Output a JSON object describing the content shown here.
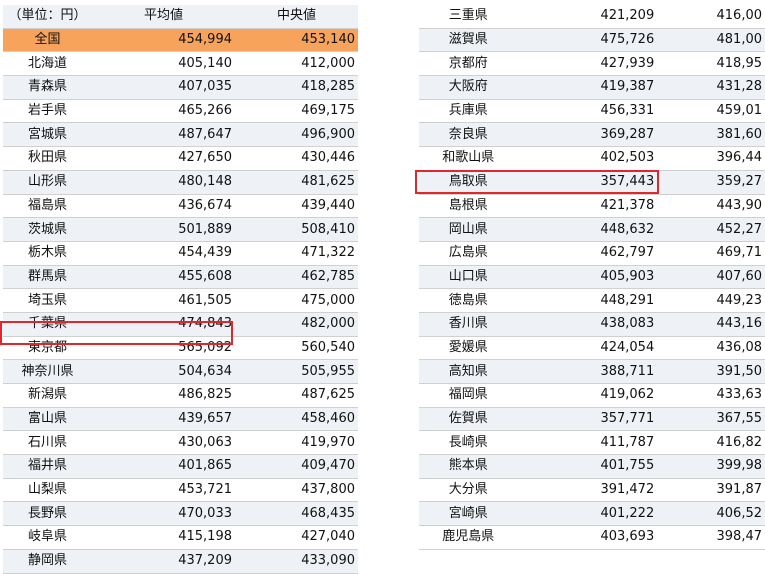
{
  "left_table": {
    "header": {
      "unit": "（単位：円）",
      "mean": "平均値",
      "median": "中央値"
    },
    "rows": [
      {
        "pref": "全国",
        "mean": "454,994",
        "median": "453,140"
      },
      {
        "pref": "北海道",
        "mean": "405,140",
        "median": "412,000"
      },
      {
        "pref": "青森県",
        "mean": "407,035",
        "median": "418,285"
      },
      {
        "pref": "岩手県",
        "mean": "465,266",
        "median": "469,175"
      },
      {
        "pref": "宮城県",
        "mean": "487,647",
        "median": "496,900"
      },
      {
        "pref": "秋田県",
        "mean": "427,650",
        "median": "430,446"
      },
      {
        "pref": "山形県",
        "mean": "480,148",
        "median": "481,625"
      },
      {
        "pref": "福島県",
        "mean": "436,674",
        "median": "439,440"
      },
      {
        "pref": "茨城県",
        "mean": "501,889",
        "median": "508,410"
      },
      {
        "pref": "栃木県",
        "mean": "454,439",
        "median": "471,322"
      },
      {
        "pref": "群馬県",
        "mean": "455,608",
        "median": "462,785"
      },
      {
        "pref": "埼玉県",
        "mean": "461,505",
        "median": "475,000"
      },
      {
        "pref": "千葉県",
        "mean": "474,843",
        "median": "482,000"
      },
      {
        "pref": "東京都",
        "mean": "565,092",
        "median": "560,540"
      },
      {
        "pref": "神奈川県",
        "mean": "504,634",
        "median": "505,955"
      },
      {
        "pref": "新潟県",
        "mean": "486,825",
        "median": "487,625"
      },
      {
        "pref": "富山県",
        "mean": "439,657",
        "median": "458,460"
      },
      {
        "pref": "石川県",
        "mean": "430,063",
        "median": "419,970"
      },
      {
        "pref": "福井県",
        "mean": "401,865",
        "median": "409,470"
      },
      {
        "pref": "山梨県",
        "mean": "453,721",
        "median": "437,800"
      },
      {
        "pref": "長野県",
        "mean": "470,033",
        "median": "468,435"
      },
      {
        "pref": "岐阜県",
        "mean": "415,198",
        "median": "427,040"
      },
      {
        "pref": "静岡県",
        "mean": "437,209",
        "median": "433,090"
      }
    ]
  },
  "right_table": {
    "rows": [
      {
        "pref": "三重県",
        "mean": "421,209",
        "median": "416,00"
      },
      {
        "pref": "滋賀県",
        "mean": "475,726",
        "median": "481,00"
      },
      {
        "pref": "京都府",
        "mean": "427,939",
        "median": "418,95"
      },
      {
        "pref": "大阪府",
        "mean": "419,387",
        "median": "431,28"
      },
      {
        "pref": "兵庫県",
        "mean": "456,331",
        "median": "459,01"
      },
      {
        "pref": "奈良県",
        "mean": "369,287",
        "median": "381,60"
      },
      {
        "pref": "和歌山県",
        "mean": "402,503",
        "median": "396,44"
      },
      {
        "pref": "鳥取県",
        "mean": "357,443",
        "median": "359,27"
      },
      {
        "pref": "島根県",
        "mean": "421,378",
        "median": "443,90"
      },
      {
        "pref": "岡山県",
        "mean": "448,632",
        "median": "452,27"
      },
      {
        "pref": "広島県",
        "mean": "462,797",
        "median": "469,71"
      },
      {
        "pref": "山口県",
        "mean": "405,903",
        "median": "407,60"
      },
      {
        "pref": "徳島県",
        "mean": "448,291",
        "median": "449,23"
      },
      {
        "pref": "香川県",
        "mean": "438,083",
        "median": "443,16"
      },
      {
        "pref": "愛媛県",
        "mean": "424,054",
        "median": "436,08"
      },
      {
        "pref": "高知県",
        "mean": "388,711",
        "median": "391,50"
      },
      {
        "pref": "福岡県",
        "mean": "419,062",
        "median": "433,63"
      },
      {
        "pref": "佐賀県",
        "mean": "357,771",
        "median": "367,55"
      },
      {
        "pref": "長崎県",
        "mean": "411,787",
        "median": "416,82"
      },
      {
        "pref": "熊本県",
        "mean": "401,755",
        "median": "399,98"
      },
      {
        "pref": "大分県",
        "mean": "391,472",
        "median": "391,87"
      },
      {
        "pref": "宮崎県",
        "mean": "401,222",
        "median": "406,52"
      },
      {
        "pref": "鹿児島県",
        "mean": "403,693",
        "median": "398,47"
      }
    ]
  },
  "highlighted": [
    "東京都",
    "鳥取県"
  ],
  "colors": {
    "national_row": "#f7a35c",
    "highlight_box": "#e3262d",
    "row_shade": "#eef1f6"
  }
}
